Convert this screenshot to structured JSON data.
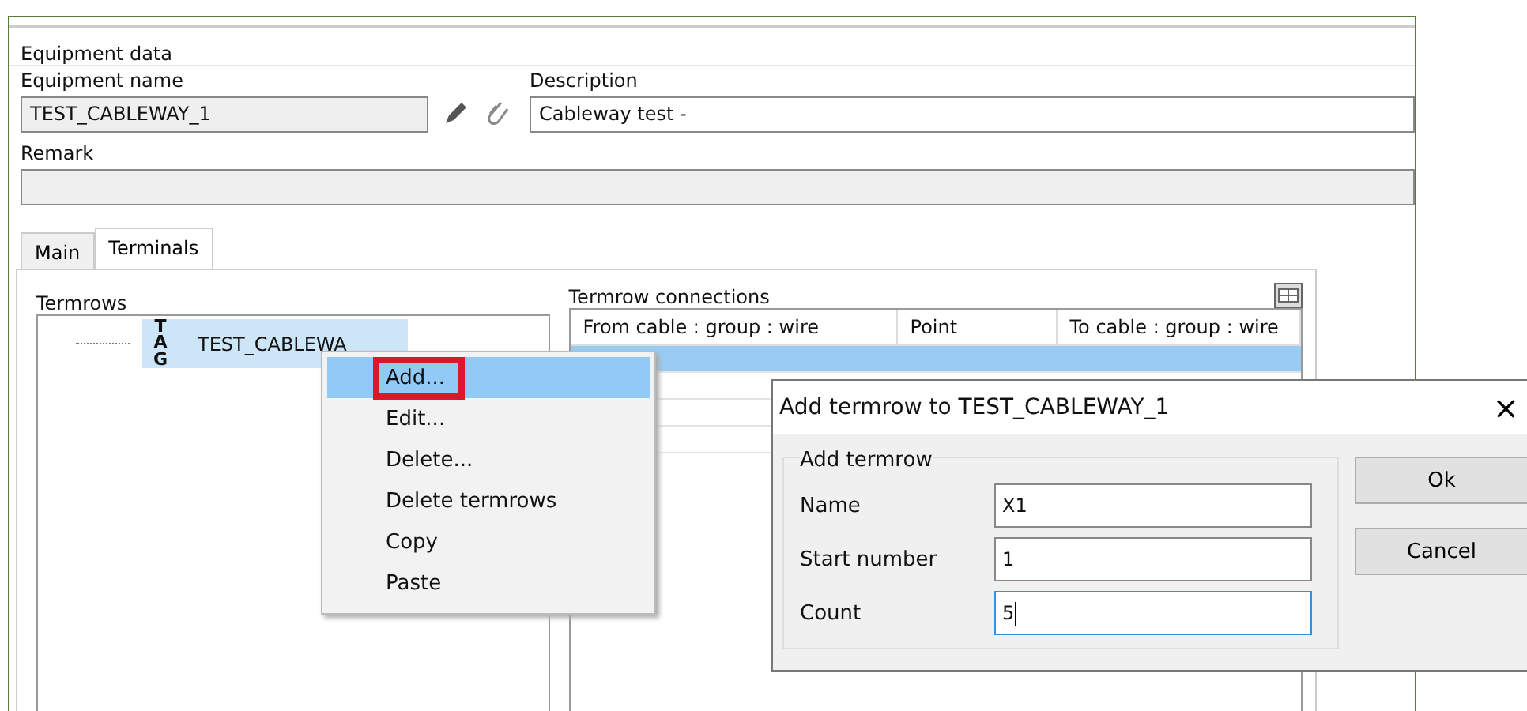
{
  "equipment": {
    "group_title": "Equipment data",
    "name_label": "Equipment name",
    "name_value": "TEST_CABLEWAY_1",
    "description_label": "Description",
    "description_value": "Cableway test -",
    "remark_label": "Remark"
  },
  "tabs": [
    {
      "label": "Main",
      "selected": false
    },
    {
      "label": "Terminals",
      "selected": true
    }
  ],
  "termrows": {
    "title": "Termrows",
    "items": [
      {
        "tag": "TAG",
        "label": "TEST_CABLEWA",
        "selected": true
      }
    ]
  },
  "connections": {
    "title": "Termrow connections",
    "columns": [
      "From cable : group : wire",
      "Point",
      "To cable : group : wire"
    ],
    "rows": [
      {
        "selected": true
      },
      {
        "selected": false
      },
      {
        "selected": false
      },
      {
        "selected": false
      }
    ]
  },
  "context_menu": {
    "items": [
      {
        "label": "Add...",
        "selected": true
      },
      {
        "label": "Edit...",
        "selected": false
      },
      {
        "label": "Delete...",
        "selected": false
      },
      {
        "label": "Delete termrows",
        "selected": false
      },
      {
        "label": "Copy",
        "selected": false
      },
      {
        "label": "Paste",
        "selected": false
      }
    ]
  },
  "dialog": {
    "title": "Add termrow to TEST_CABLEWAY_1",
    "close": "×",
    "group_title": "Add termrow",
    "fields": [
      {
        "label": "Name",
        "value": "X1",
        "focused": false
      },
      {
        "label": "Start number",
        "value": "1",
        "focused": false
      },
      {
        "label": "Count",
        "value": "5",
        "focused": true
      }
    ],
    "buttons": [
      "Ok",
      "Cancel"
    ]
  }
}
